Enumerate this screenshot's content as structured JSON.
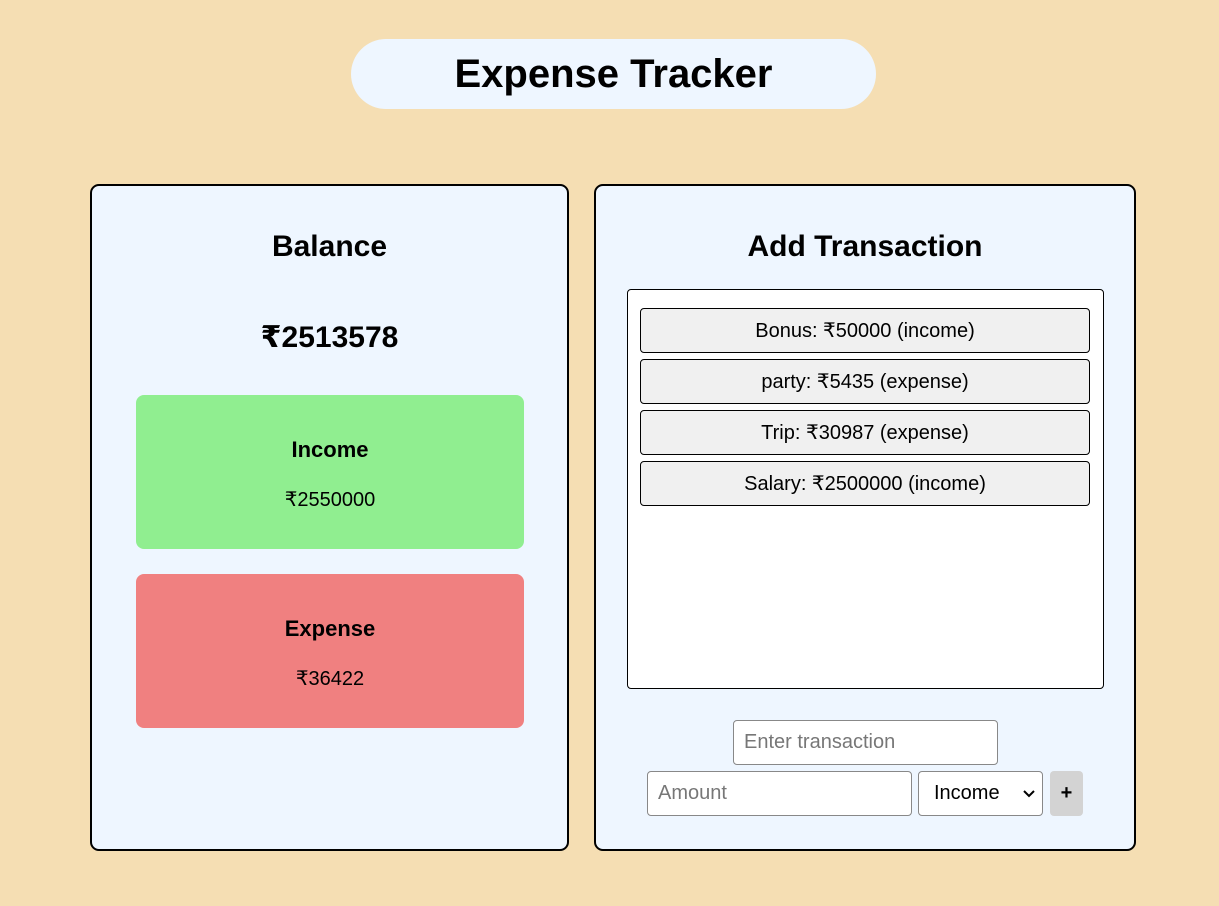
{
  "app": {
    "title": "Expense Tracker"
  },
  "balance": {
    "heading": "Balance",
    "amount": "₹2513578",
    "income": {
      "label": "Income",
      "value": "₹2550000",
      "color": "#90ee90"
    },
    "expense": {
      "label": "Expense",
      "value": "₹36422",
      "color": "#f08080"
    }
  },
  "add_transaction": {
    "heading": "Add Transaction",
    "transactions": [
      {
        "text": "Bonus: ₹50000 (income)"
      },
      {
        "text": "party: ₹5435 (expense)"
      },
      {
        "text": "Trip: ₹30987 (expense)"
      },
      {
        "text": "Salary: ₹2500000 (income)"
      }
    ],
    "form": {
      "description_placeholder": "Enter transaction",
      "description_value": "",
      "amount_placeholder": "Amount",
      "amount_value": "",
      "type_selected": "Income",
      "add_label": "+"
    }
  },
  "colors": {
    "page_background": "#f5deb3",
    "panel_background": "#eef6ff",
    "item_background": "#f0f0f0",
    "button_background": "#d3d3d3"
  }
}
